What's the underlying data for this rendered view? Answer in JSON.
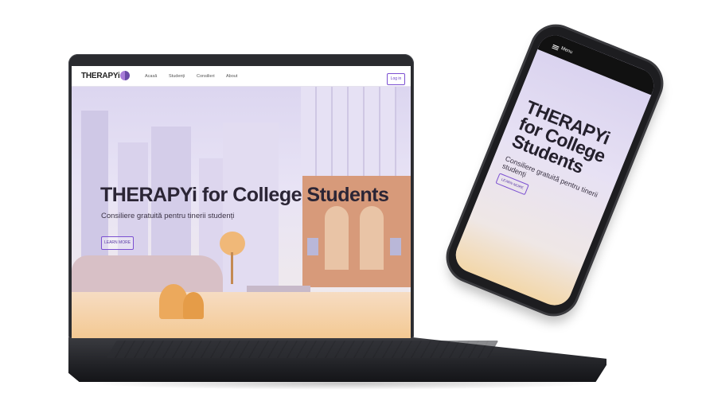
{
  "site": {
    "brand": "THERAPYi",
    "nav_links": [
      "Acasă",
      "Studenți",
      "Consilieri",
      "About"
    ],
    "login_label": "Log in",
    "hero_title": "THERAPYi for College Students",
    "hero_subtitle": "Consiliere gratuită pentru tinerii studenți",
    "learn_more_label": "LEARN MORE"
  },
  "phone": {
    "menu_label": "Menu",
    "hero_title": "THERAPYi for College Students",
    "hero_subtitle": "Consiliere gratuită pentru tinerii studenți",
    "learn_more_label": "LEARN MORE"
  },
  "colors": {
    "accent": "#7b4fd1",
    "device": "#2a2b2f",
    "title_text": "#2b2535"
  },
  "icons": [
    "brand-logo-icon",
    "menu-icon"
  ]
}
